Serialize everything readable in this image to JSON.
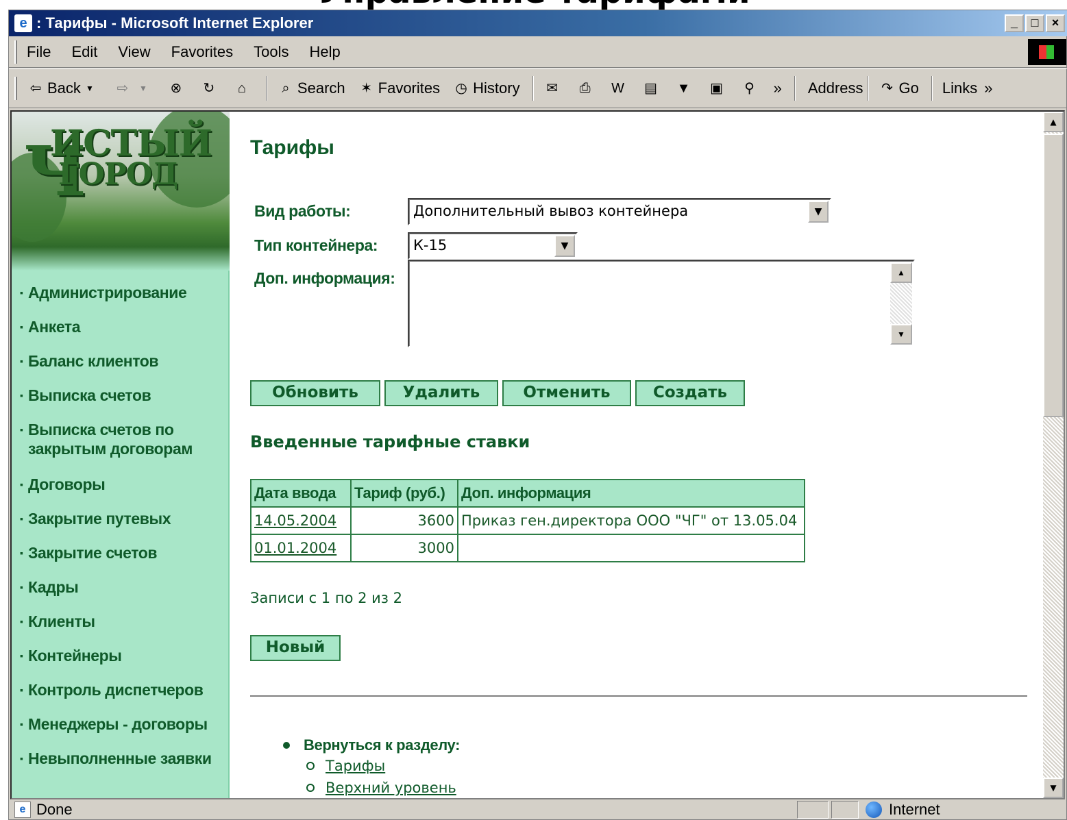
{
  "slide": {
    "heading": "Управление тарифами"
  },
  "window": {
    "title": ": Тарифы - Microsoft Internet Explorer",
    "minimize": "_",
    "maximize": "□",
    "close": "×"
  },
  "menu": {
    "items": [
      {
        "label": "File"
      },
      {
        "label": "Edit"
      },
      {
        "label": "View"
      },
      {
        "label": "Favorites"
      },
      {
        "label": "Tools"
      },
      {
        "label": "Help"
      }
    ]
  },
  "toolbar": {
    "back": "Back",
    "search": "Search",
    "favorites": "Favorites",
    "history": "History",
    "address": "Address",
    "go": "Go",
    "links": "Links",
    "chevron": "»"
  },
  "sidebar": {
    "logo_line1": "ИСТЫЙ",
    "logo_line2": "ГОРОД",
    "logo_big": "Ч",
    "items": [
      {
        "label": "Администрирование"
      },
      {
        "label": "Анкета"
      },
      {
        "label": "Баланс клиентов"
      },
      {
        "label": "Выписка счетов"
      },
      {
        "label": "Выписка счетов по закрытым договорам"
      },
      {
        "label": "Договоры"
      },
      {
        "label": "Закрытие путевых"
      },
      {
        "label": "Закрытие счетов"
      },
      {
        "label": "Кадры"
      },
      {
        "label": "Клиенты"
      },
      {
        "label": "Контейнеры"
      },
      {
        "label": "Контроль диспетчеров"
      },
      {
        "label": "Менеджеры - договоры"
      },
      {
        "label": "Невыполненные заявки"
      }
    ]
  },
  "main": {
    "title": "Тарифы",
    "form": {
      "work_type_label": "Вид работы:",
      "work_type_value": "Дополнительный вывоз контейнера",
      "container_label": "Тип контейнера:",
      "container_value": "К-15",
      "info_label": "Доп. информация:",
      "info_value": ""
    },
    "buttons": {
      "update": "Обновить",
      "delete": "Удалить",
      "cancel": "Отменить",
      "create": "Создать"
    },
    "rates_title": "Введенные тарифные ставки",
    "table": {
      "headers": [
        "Дата ввода",
        "Тариф (руб.)",
        "Доп. информация"
      ],
      "rows": [
        [
          "14.05.2004",
          "3600",
          "Приказ ген.директора ООО \"ЧГ\" от 13.05.04"
        ],
        [
          "01.01.2004",
          "3000",
          ""
        ]
      ]
    },
    "records": "Записи с 1 по 2 из 2",
    "new_button": "Новый",
    "back": {
      "label": "Вернуться к разделу:",
      "links": [
        "Тарифы",
        "Верхний уровень"
      ]
    }
  },
  "status": {
    "text": "Done",
    "zone": "Internet"
  }
}
